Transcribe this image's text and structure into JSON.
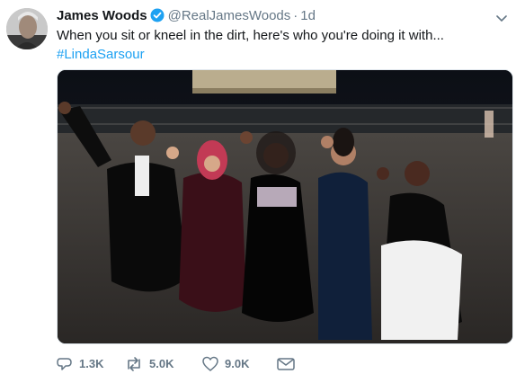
{
  "author": {
    "name": "James Woods",
    "handle": "@RealJamesWoods",
    "separator": "·",
    "time": "1d"
  },
  "tweet": {
    "text": "When you sit or kneel in the dirt, here's who you're doing it with...",
    "hashtag": "#LindaSarsour"
  },
  "icons": {
    "verified": "verified-badge-icon",
    "menu": "chevron-down-icon",
    "reply": "reply-icon",
    "retweet": "retweet-icon",
    "like": "heart-icon",
    "dm": "envelope-icon"
  },
  "actions": {
    "reply_count": "1.3K",
    "retweet_count": "5.0K",
    "like_count": "9.0K"
  },
  "colors": {
    "link": "#1da1f2",
    "muted": "#657786",
    "text": "#14171a"
  }
}
